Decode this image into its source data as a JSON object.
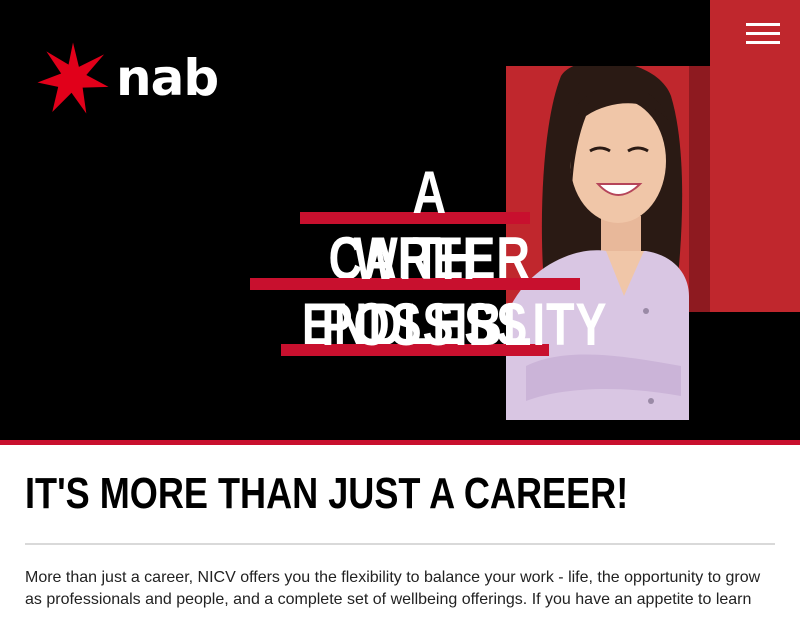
{
  "header": {
    "logo_text": "nab",
    "logo_icon": "star-icon",
    "menu_icon": "hamburger-menu-icon"
  },
  "hero": {
    "headline_lines": [
      "A CAREER",
      "WITH ENDLESS",
      "POSSIBLITY"
    ]
  },
  "main": {
    "title": "IT'S MORE THAN JUST A CAREER!",
    "intro": "More than just a career, NICV offers you the flexibility to balance your work - life, the opportunity to grow as professionals and people, and a complete set of wellbeing offerings. If you have an appetite to learn"
  },
  "colors": {
    "brand_red": "#c8102e",
    "hero_bg": "#000000",
    "panel_red": "#c0272d"
  }
}
